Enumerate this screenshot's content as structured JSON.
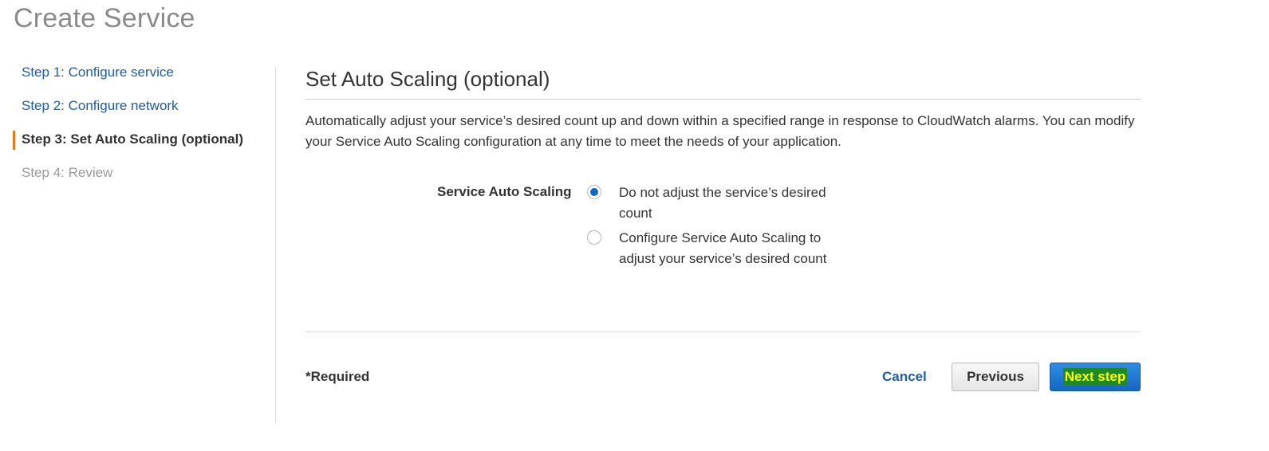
{
  "page": {
    "title": "Create Service"
  },
  "wizard": {
    "steps": [
      {
        "label": "Step 1: Configure service",
        "state": "link"
      },
      {
        "label": "Step 2: Configure network",
        "state": "link"
      },
      {
        "label": "Step 3: Set Auto Scaling (optional)",
        "state": "active"
      },
      {
        "label": "Step 4: Review",
        "state": "disabled"
      }
    ]
  },
  "section": {
    "title": "Set Auto Scaling (optional)",
    "description": "Automatically adjust your service’s desired count up and down within a specified range in response to CloudWatch alarms. You can modify your Service Auto Scaling configuration at any time to meet the needs of your application."
  },
  "auto_scaling": {
    "label": "Service Auto Scaling",
    "options": [
      {
        "label": "Do not adjust the service’s desired count",
        "selected": true
      },
      {
        "label": "Configure Service Auto Scaling to adjust your service’s desired count",
        "selected": false
      }
    ]
  },
  "footer": {
    "required_note": "*Required",
    "cancel_label": "Cancel",
    "previous_label": "Previous",
    "next_label": "Next step"
  },
  "colors": {
    "link": "#1a5ea8",
    "active_step_marker": "#e0781f",
    "primary_button": "#1666c2",
    "radio_selected": "#1266c4",
    "next_label_highlight_bg": "#1f8a1f",
    "next_label_highlight_fg": "#ffff00"
  }
}
